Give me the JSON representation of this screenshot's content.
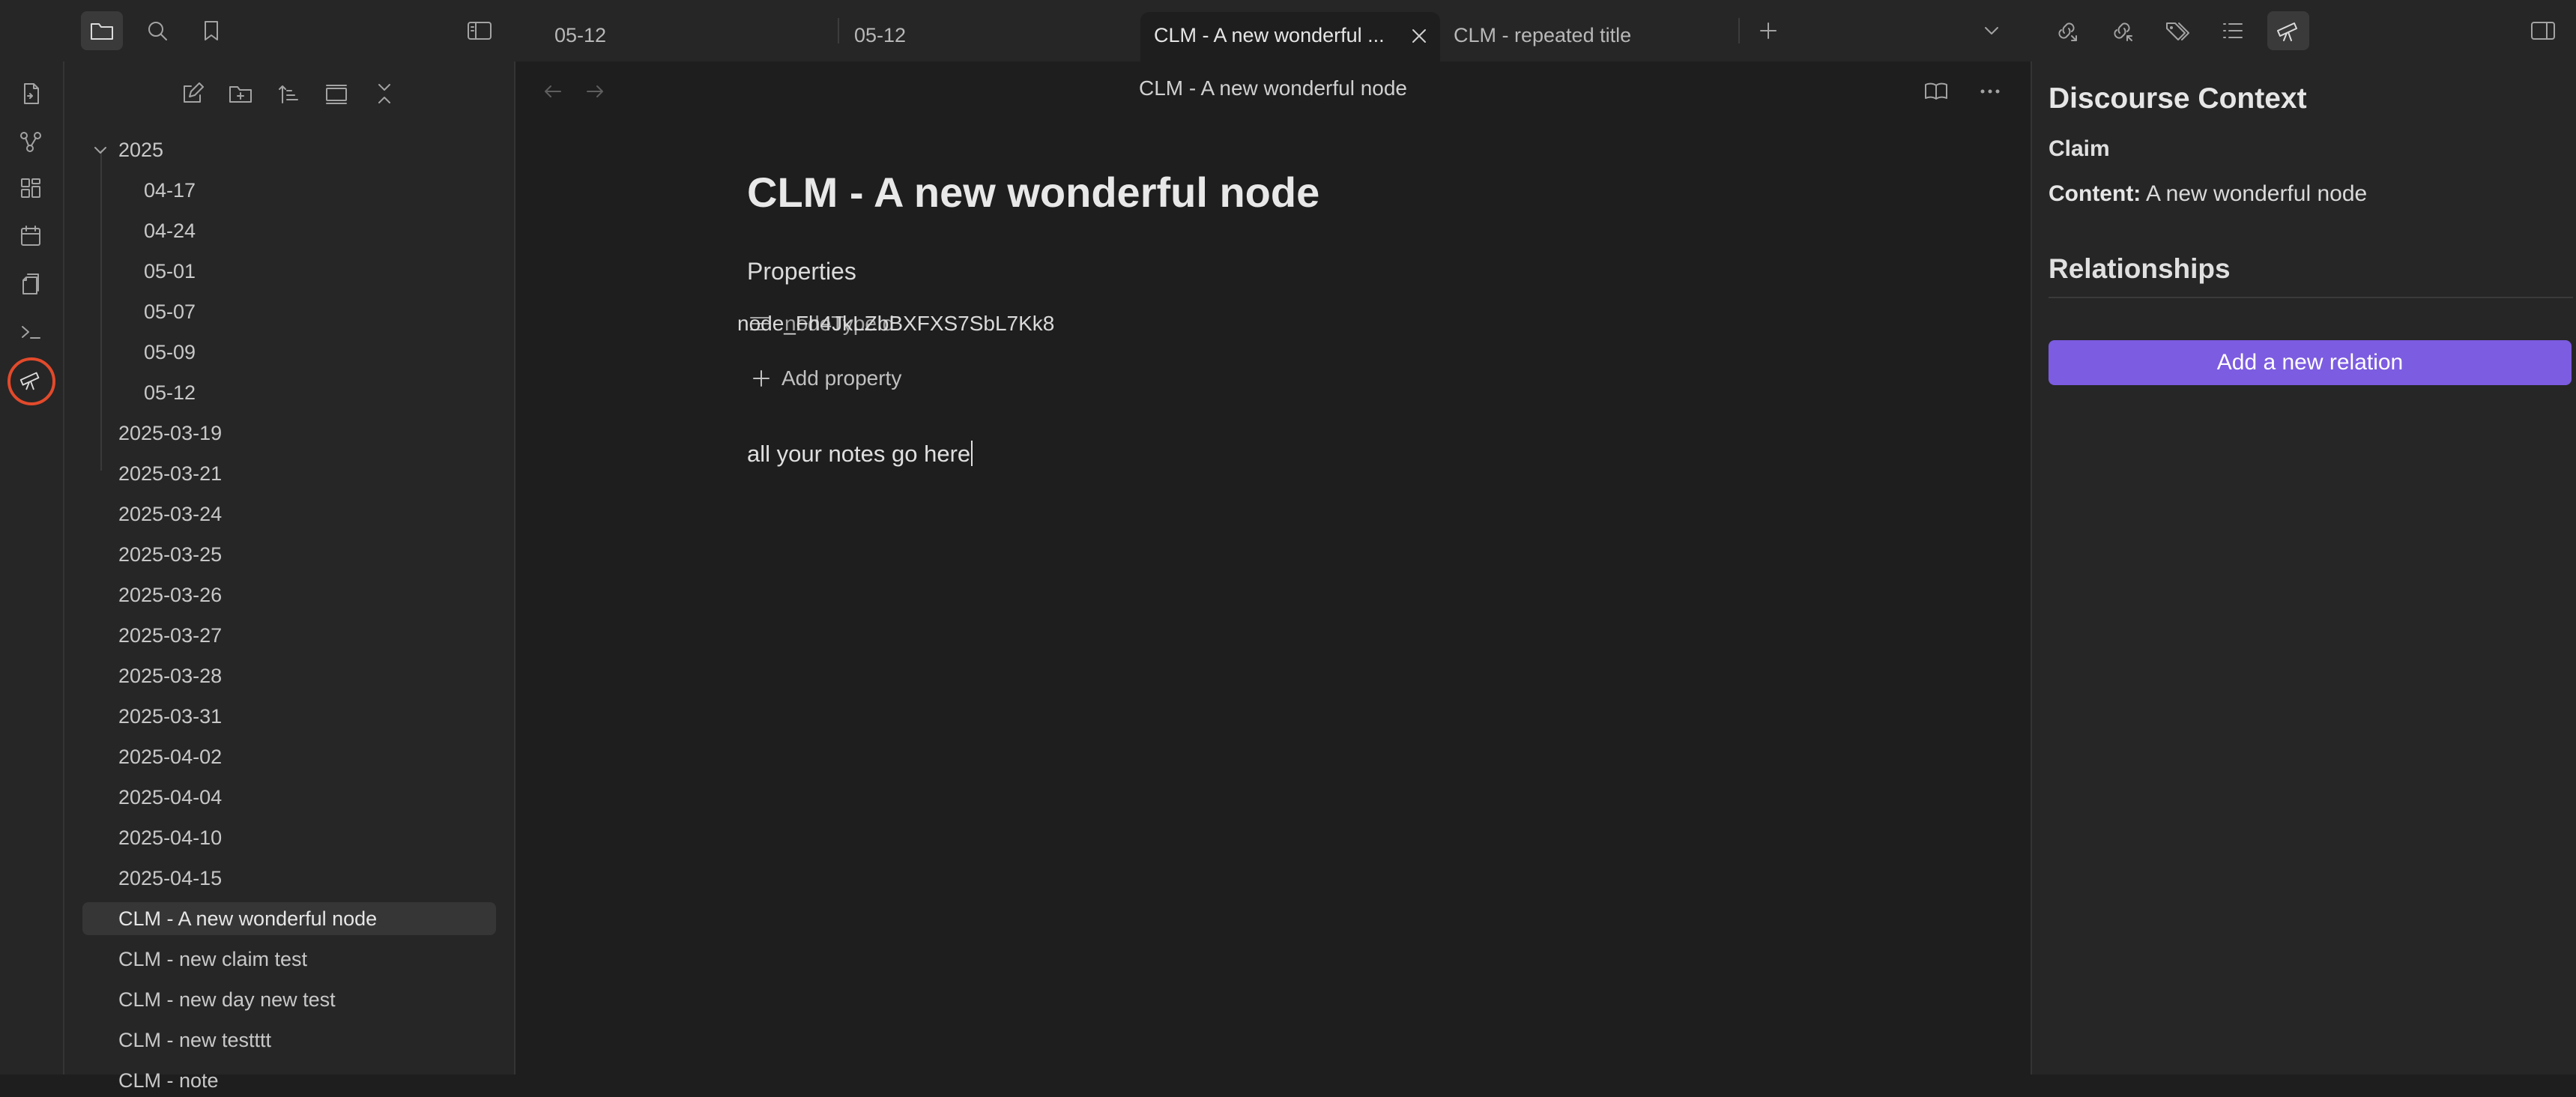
{
  "tabs": [
    {
      "label": "05-12",
      "active": false
    },
    {
      "label": "05-12",
      "active": false
    },
    {
      "label": "CLM - A new wonderful ...",
      "active": true
    },
    {
      "label": "CLM - repeated title",
      "active": false
    }
  ],
  "icons": {
    "top_left": [
      "folder-icon",
      "search-icon",
      "bookmark-icon",
      "sidebar-toggle-icon"
    ],
    "top_right": [
      "outgoing-links-icon",
      "backlinks-icon",
      "tags-icon",
      "outline-icon",
      "telescope-icon",
      "right-sidebar-toggle-icon"
    ],
    "ribbon": [
      "open-quick-switcher-icon",
      "graph-view-icon",
      "canvas-icon",
      "daily-note-icon",
      "templates-icon",
      "command-palette-icon",
      "discourse-graph-icon"
    ]
  },
  "explorer": {
    "items": [
      {
        "label": "2025",
        "level": 0,
        "expanded": true
      },
      {
        "label": "04-17",
        "level": 1
      },
      {
        "label": "04-24",
        "level": 1
      },
      {
        "label": "05-01",
        "level": 1
      },
      {
        "label": "05-07",
        "level": 1
      },
      {
        "label": "05-09",
        "level": 1
      },
      {
        "label": "05-12",
        "level": 1
      },
      {
        "label": "2025-03-19",
        "level": 0
      },
      {
        "label": "2025-03-21",
        "level": 0
      },
      {
        "label": "2025-03-24",
        "level": 0
      },
      {
        "label": "2025-03-25",
        "level": 0
      },
      {
        "label": "2025-03-26",
        "level": 0
      },
      {
        "label": "2025-03-27",
        "level": 0
      },
      {
        "label": "2025-03-28",
        "level": 0
      },
      {
        "label": "2025-03-31",
        "level": 0
      },
      {
        "label": "2025-04-02",
        "level": 0
      },
      {
        "label": "2025-04-04",
        "level": 0
      },
      {
        "label": "2025-04-10",
        "level": 0
      },
      {
        "label": "2025-04-15",
        "level": 0
      },
      {
        "label": "CLM - A new wonderful node",
        "level": 0,
        "selected": true
      },
      {
        "label": "CLM - new claim test",
        "level": 0
      },
      {
        "label": "CLM - new day new test",
        "level": 0
      },
      {
        "label": "CLM - new testttt",
        "level": 0
      },
      {
        "label": "CLM - note",
        "level": 0
      }
    ]
  },
  "main": {
    "view_title": "CLM - A new wonderful node",
    "note_title": "CLM - A new wonderful node",
    "properties_heading": "Properties",
    "property": {
      "key": "nodeTypeId",
      "value": "node_Fh4JkLZbBXFXS7SbL7Kk8"
    },
    "add_property": "Add property",
    "body": "all your notes go here"
  },
  "discourse": {
    "title": "Discourse Context",
    "node_type": "Claim",
    "content_label": "Content:",
    "content_value": "A new wonderful node",
    "relationships_heading": "Relationships",
    "add_relation_label": "Add a new relation"
  },
  "colors": {
    "accent": "#7c5ce0",
    "highlight_ring": "#e24a2b"
  }
}
